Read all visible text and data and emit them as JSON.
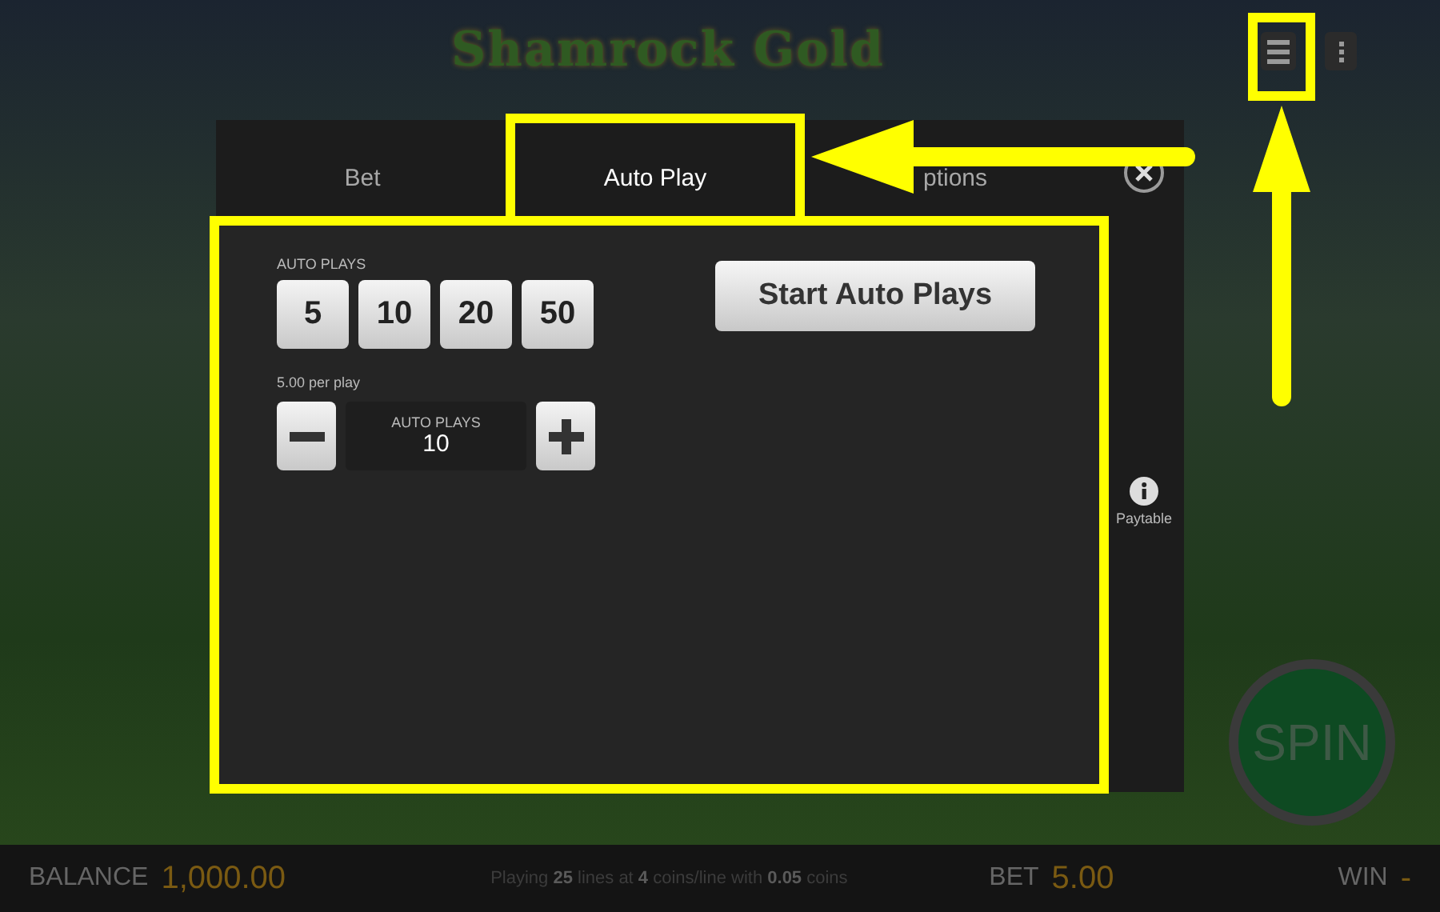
{
  "logo": {
    "text": "Shamrock Gold"
  },
  "tabs": [
    {
      "label": "Bet",
      "selected": false
    },
    {
      "label": "Auto Play",
      "selected": true
    },
    {
      "label": "ptions",
      "selected": false
    }
  ],
  "auto_plays": {
    "label": "AUTO PLAYS",
    "presets": [
      "5",
      "10",
      "20",
      "50"
    ],
    "per_play": "5.00 per play",
    "counter": {
      "label": "AUTO PLAYS",
      "value": "10"
    }
  },
  "start_button": "Start Auto Plays",
  "paytable": {
    "label": "Paytable"
  },
  "spin": "SPIN",
  "status_bar": {
    "balance_label": "BALANCE",
    "balance": "1,000.00",
    "info": "Playing **25** lines at **4** coins/line with **0.05** coins",
    "bet_label": "BET",
    "bet": "5.00",
    "win_label": "WIN",
    "win": "-"
  }
}
